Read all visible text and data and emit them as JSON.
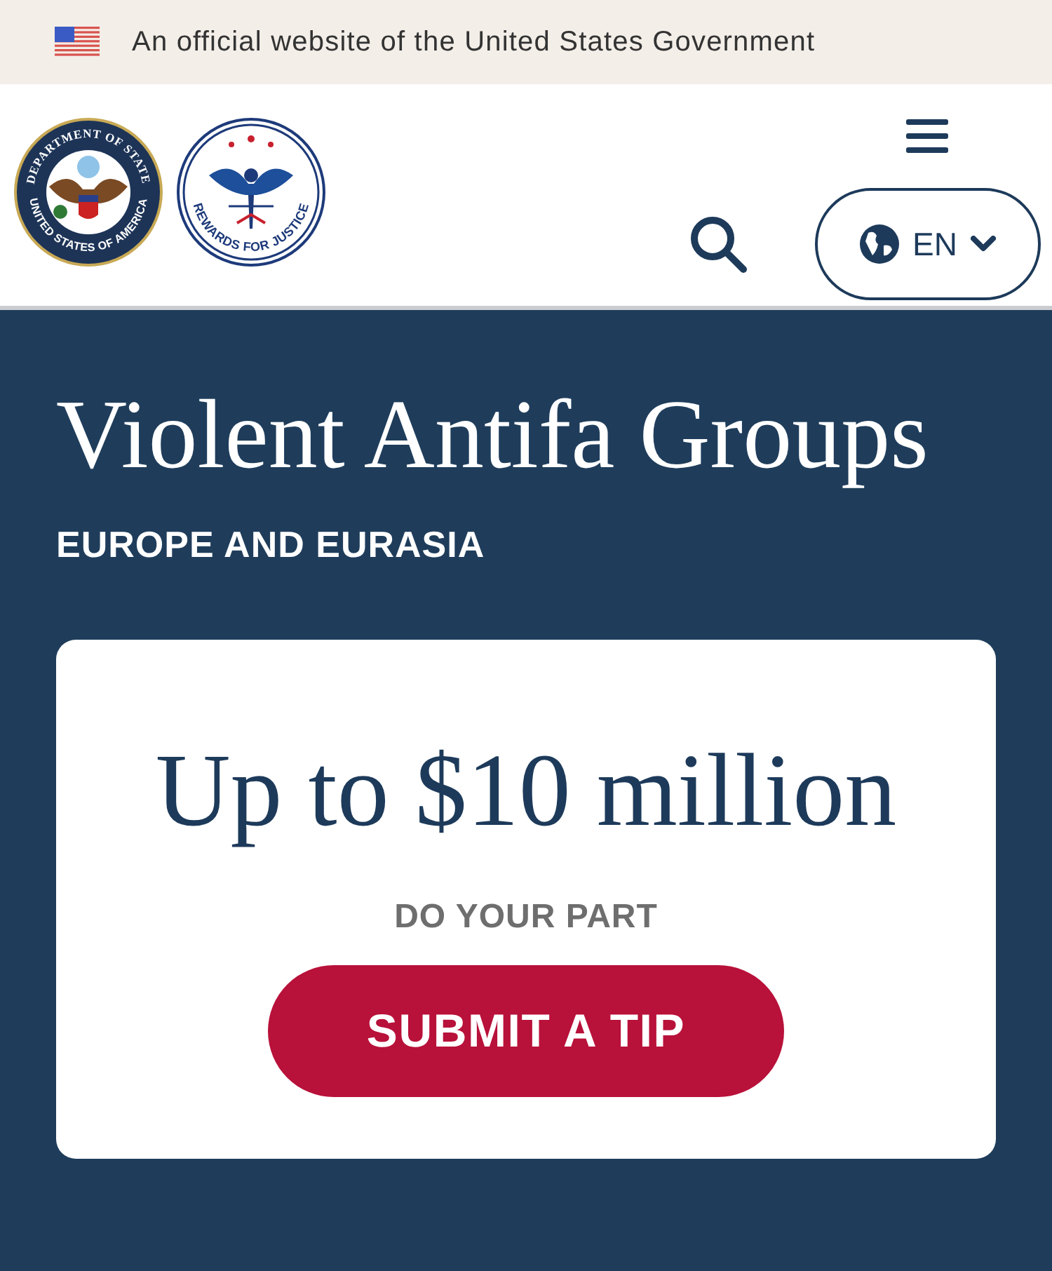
{
  "banner": {
    "text": "An official website of the United States Government"
  },
  "logos": [
    {
      "top_text": "DEPARTMENT OF STATE",
      "bottom_text": "UNITED STATES OF AMERICA"
    },
    {
      "bottom_text": "REWARDS FOR JUSTICE"
    }
  ],
  "language": {
    "label": "EN"
  },
  "hero": {
    "title": "Violent Antifa Groups",
    "region": "EUROPE AND EURASIA"
  },
  "reward": {
    "amount": "Up to $10 million",
    "prompt": "DO YOUR PART",
    "button": "SUBMIT A TIP"
  }
}
